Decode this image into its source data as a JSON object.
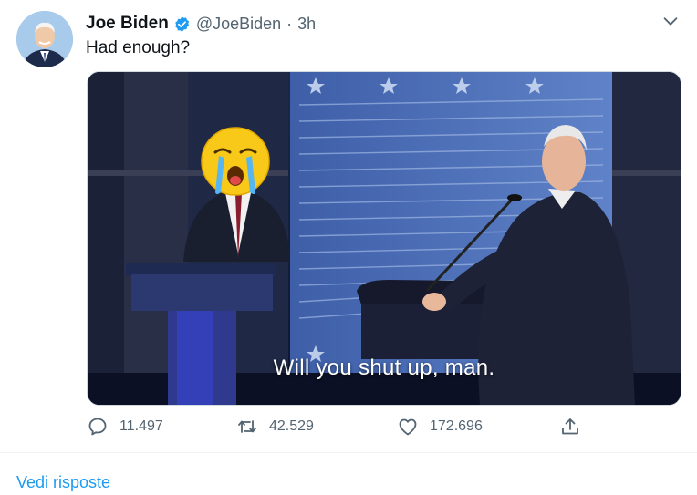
{
  "tweet": {
    "author_name": "Joe Biden",
    "handle": "@JoeBiden",
    "separator": "·",
    "time": "3h",
    "verified": true,
    "text": "Had enough?",
    "media": {
      "caption": "Will you shut up, man.",
      "overlay_emoji": "😭"
    }
  },
  "actions": {
    "replies": "11.497",
    "retweets": "42.529",
    "likes": "172.696"
  },
  "footer": {
    "see_replies": "Vedi risposte"
  },
  "colors": {
    "link": "#1d9bf0",
    "muted": "#536471",
    "verified": "#1d9bf0"
  },
  "icons": [
    "verified-badge-icon",
    "chevron-down-icon",
    "reply-icon",
    "retweet-icon",
    "like-icon",
    "share-icon"
  ]
}
